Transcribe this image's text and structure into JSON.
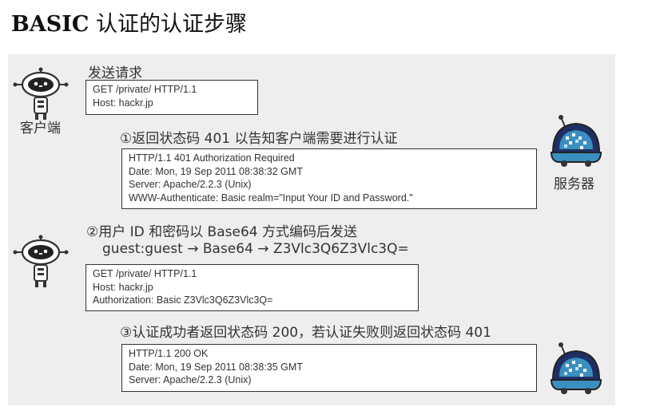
{
  "title": {
    "bold": "BASIC",
    "rest": " 认证的认证步骤"
  },
  "client_label": "客户端",
  "server_label": "服务器",
  "request1": {
    "caption": "发送请求",
    "lines": [
      "GET /private/ HTTP/1.1",
      "Host: hackr.jp"
    ]
  },
  "step1": {
    "text": "①返回状态码 401 以告知客户端需要进行认证",
    "lines": [
      "HTTP/1.1 401 Authorization Required",
      "Date: Mon, 19 Sep 2011 08:38:32 GMT",
      "Server: Apache/2.2.3 (Unix)",
      "WWW-Authenticate: Basic realm=\"Input Your ID and Password.\""
    ]
  },
  "step2": {
    "text": "②用户 ID 和密码以 Base64 方式编码后发送",
    "formula": "guest:guest → Base64 → Z3Vlc3Q6Z3Vlc3Q=",
    "lines": [
      "GET /private/ HTTP/1.1",
      "Host: hackr.jp",
      "Authorization: Basic Z3Vlc3Q6Z3Vlc3Q="
    ]
  },
  "step3": {
    "text": "③认证成功者返回状态码 200，若认证失败则返回状态码 401",
    "lines": [
      "HTTP/1.1 200 OK",
      "Date: Mon, 19 Sep 2011 08:38:35 GMT",
      "Server: Apache/2.2.3 (Unix)"
    ]
  },
  "icons": {
    "client": "robot-icon",
    "server": "dome-robot-icon"
  }
}
